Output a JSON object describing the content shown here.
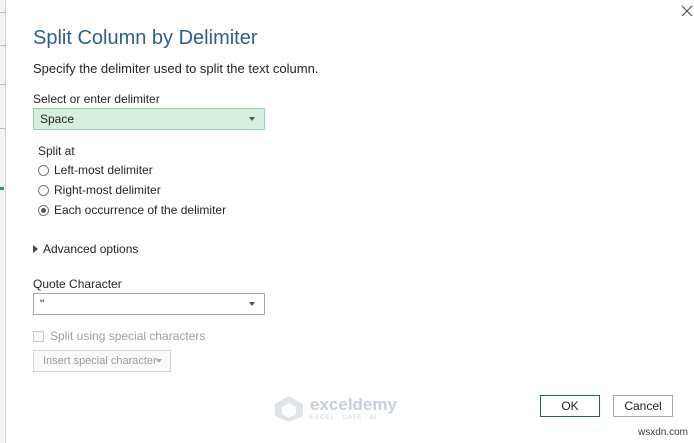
{
  "dialog": {
    "title": "Split Column by Delimiter",
    "subtitle": "Specify the delimiter used to split the text column."
  },
  "delimiter": {
    "label": "Select or enter delimiter",
    "selected": "Space"
  },
  "split_at": {
    "label": "Split at",
    "options": [
      {
        "label": "Left-most delimiter",
        "checked": false
      },
      {
        "label": "Right-most delimiter",
        "checked": false
      },
      {
        "label": "Each occurrence of the delimiter",
        "checked": true
      }
    ]
  },
  "advanced": {
    "label": "Advanced options"
  },
  "quote": {
    "label": "Quote Character",
    "selected": "\""
  },
  "special": {
    "checkbox_label": "Split using special characters",
    "insert_label": "Insert special character"
  },
  "buttons": {
    "ok": "OK",
    "cancel": "Cancel"
  },
  "watermark": {
    "name": "exceldemy",
    "tagline": "EXCEL · DATA · BI"
  },
  "site": "wsxdn.com",
  "colors": {
    "title": "#2f5f8a",
    "selected_dropdown": "#d5f0df",
    "ok_border": "#1f6b45"
  }
}
